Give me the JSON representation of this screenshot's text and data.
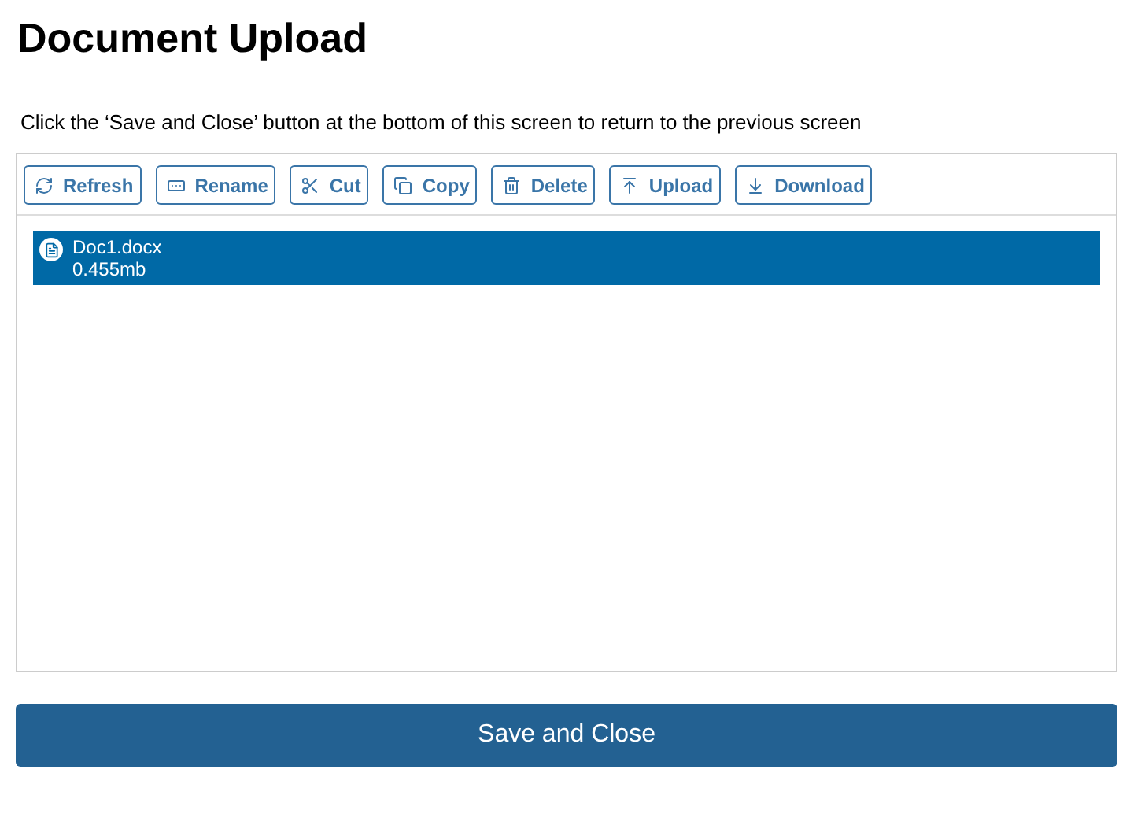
{
  "title": "Document Upload",
  "instruction": "Click the ‘Save and Close’ button at the bottom of this screen to return to the previous screen",
  "toolbar": [
    {
      "kind": "refresh",
      "label": "Refresh"
    },
    {
      "kind": "rename",
      "label": "Rename"
    },
    {
      "kind": "cut",
      "label": "Cut"
    },
    {
      "kind": "copy",
      "label": "Copy"
    },
    {
      "kind": "delete",
      "label": "Delete"
    },
    {
      "kind": "upload",
      "label": "Upload"
    },
    {
      "kind": "download",
      "label": "Download"
    }
  ],
  "files": [
    {
      "name": "Doc1.docx",
      "size": "0.455mb",
      "selected": true
    }
  ],
  "save_button": "Save and Close"
}
